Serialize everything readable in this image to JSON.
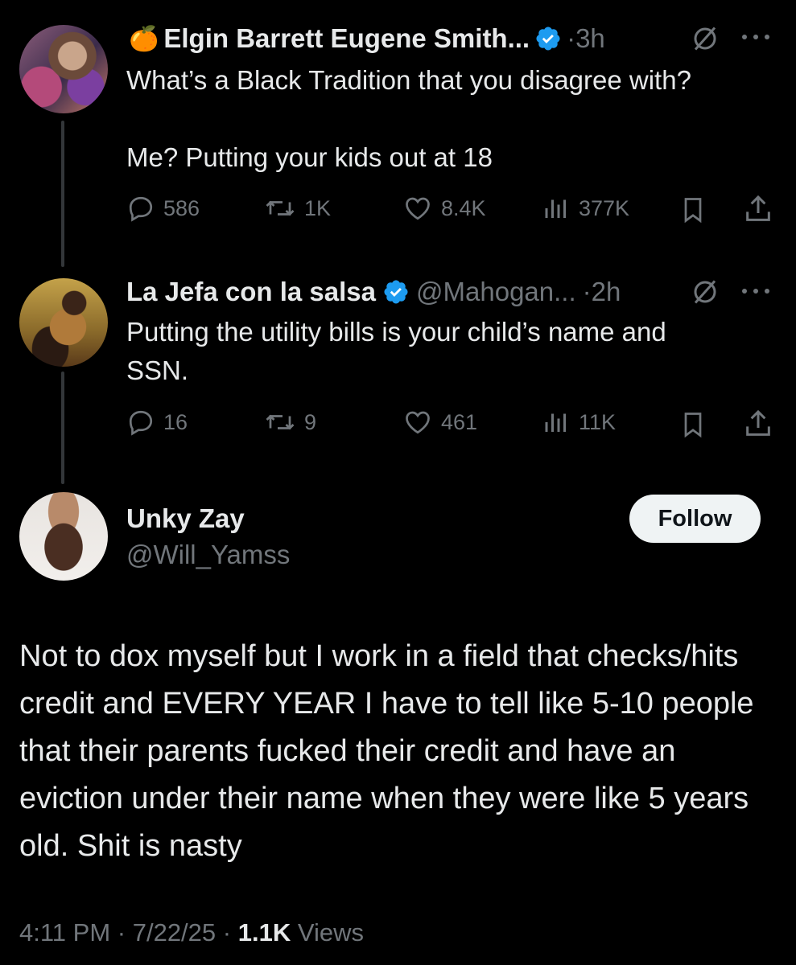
{
  "tweet1": {
    "emoji": "🍊",
    "name": "Elgin Barrett Eugene Smith...",
    "time": "·3h",
    "text_line1": "What’s a Black Tradition that you disagree with?",
    "text_line2": "Me? Putting your kids out at 18",
    "replies": "586",
    "reposts": "1K",
    "likes": "8.4K",
    "views": "377K"
  },
  "tweet2": {
    "name": "La Jefa con la salsa",
    "handle": "@Mahogan...",
    "time": "·2h",
    "text_line1": "Putting the utility bills is your child’s name and",
    "text_line2": "SSN.",
    "replies": "16",
    "reposts": "9",
    "likes": "461",
    "views": "11K"
  },
  "main": {
    "name": "Unky Zay",
    "handle": "@Will_Yamss",
    "follow_label": "Follow",
    "text": "Not to dox myself but I work in a field that checks/hits credit and EVERY YEAR I have to tell like 5-10 people that their parents fucked their credit and have an eviction under their name when they were like 5 years old. Shit is nasty",
    "time": "4:11 PM",
    "date": "7/22/25",
    "views_count": "1.1K",
    "views_label": "Views"
  },
  "colors": {
    "background": "#000000",
    "text": "#e7e9ea",
    "muted": "#71767b",
    "verified": "#1d9bf0"
  }
}
